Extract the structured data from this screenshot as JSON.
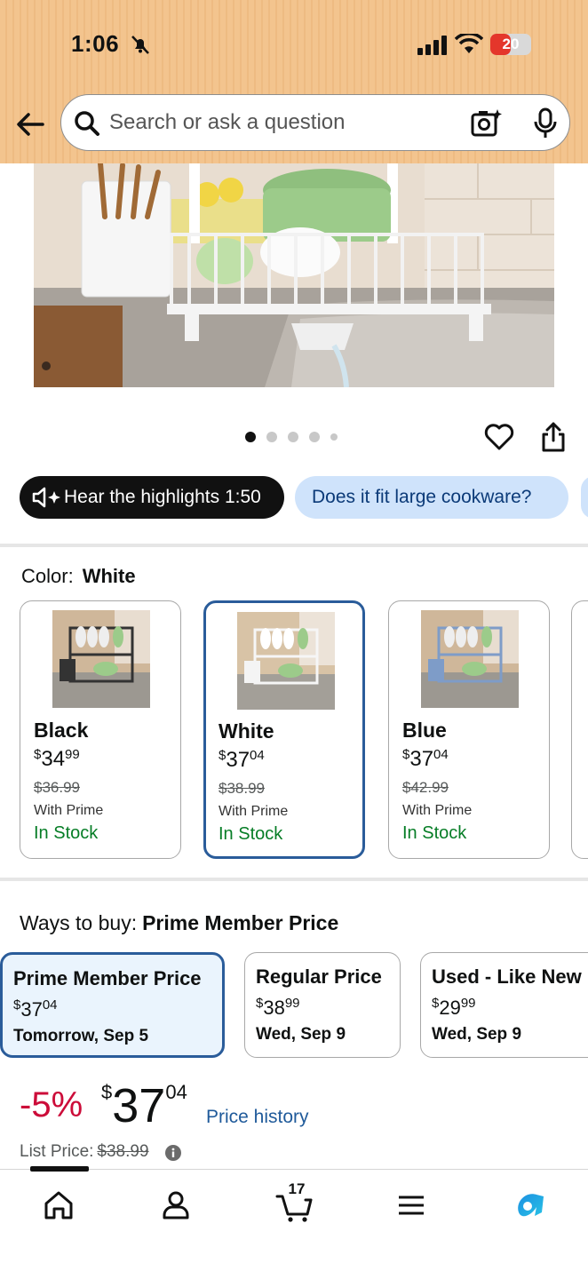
{
  "status_bar": {
    "time": "1:06",
    "battery": "20",
    "battery_level": 0.2,
    "battery_color": "#e4362b"
  },
  "search": {
    "placeholder": "Search or ask a question"
  },
  "carousel": {
    "page_count": 5,
    "active_index": 0
  },
  "chips": {
    "hear": "Hear the highlights 1:50",
    "question": "Does it fit large cookware?"
  },
  "color": {
    "label": "Color:",
    "selected": "White",
    "options": [
      {
        "name": "Black",
        "price_sym": "$",
        "price_whole": "34",
        "price_frac": "99",
        "list_price": "$36.99",
        "prime": "With Prime",
        "stock": "In Stock"
      },
      {
        "name": "White",
        "price_sym": "$",
        "price_whole": "37",
        "price_frac": "04",
        "list_price": "$38.99",
        "prime": "With Prime",
        "stock": "In Stock"
      },
      {
        "name": "Blue",
        "price_sym": "$",
        "price_whole": "37",
        "price_frac": "04",
        "list_price": "$42.99",
        "prime": "With Prime",
        "stock": "In Stock"
      }
    ]
  },
  "ways_to_buy": {
    "label": "Ways to buy:",
    "selected": "Prime Member Price",
    "options": [
      {
        "title": "Prime Member Price",
        "price_sym": "$",
        "price_whole": "37",
        "price_frac": "04",
        "date": "Tomorrow, Sep 5"
      },
      {
        "title": "Regular Price",
        "price_sym": "$",
        "price_whole": "38",
        "price_frac": "99",
        "date": "Wed, Sep 9"
      },
      {
        "title": "Used - Like New",
        "price_sym": "$",
        "price_whole": "29",
        "price_frac": "99",
        "date": "Wed, Sep 9"
      }
    ]
  },
  "price": {
    "discount": "-5%",
    "sym": "$",
    "whole": "37",
    "frac": "04",
    "history_link": "Price history",
    "list_label": "List Price:",
    "list_value": "$38.99"
  },
  "nav": {
    "cart_count": "17"
  },
  "colors": {
    "accent_blue": "#2a5c9a",
    "stock_green": "#067d26",
    "deal_red": "#cc0c39",
    "chip_blue": "#cfe3fb"
  }
}
